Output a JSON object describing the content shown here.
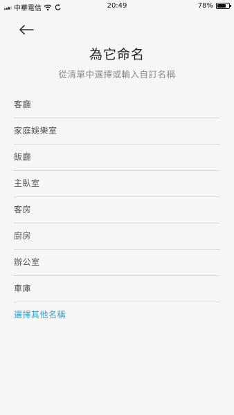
{
  "status": {
    "carrier": "中華電信",
    "time": "20:49",
    "battery": "78%",
    "battery_level": 0.78
  },
  "header": {
    "title": "為它命名",
    "subtitle": "從清單中選擇或輸入自訂名稱"
  },
  "rooms": [
    "客廳",
    "家庭娛樂室",
    "飯廳",
    "主臥室",
    "客房",
    "廚房",
    "辦公室",
    "車庫"
  ],
  "other_name_label": "選擇其他名稱",
  "colors": {
    "background": "#f6f6f6",
    "link": "#3aa0c4",
    "divider": "#dcdcdc"
  }
}
